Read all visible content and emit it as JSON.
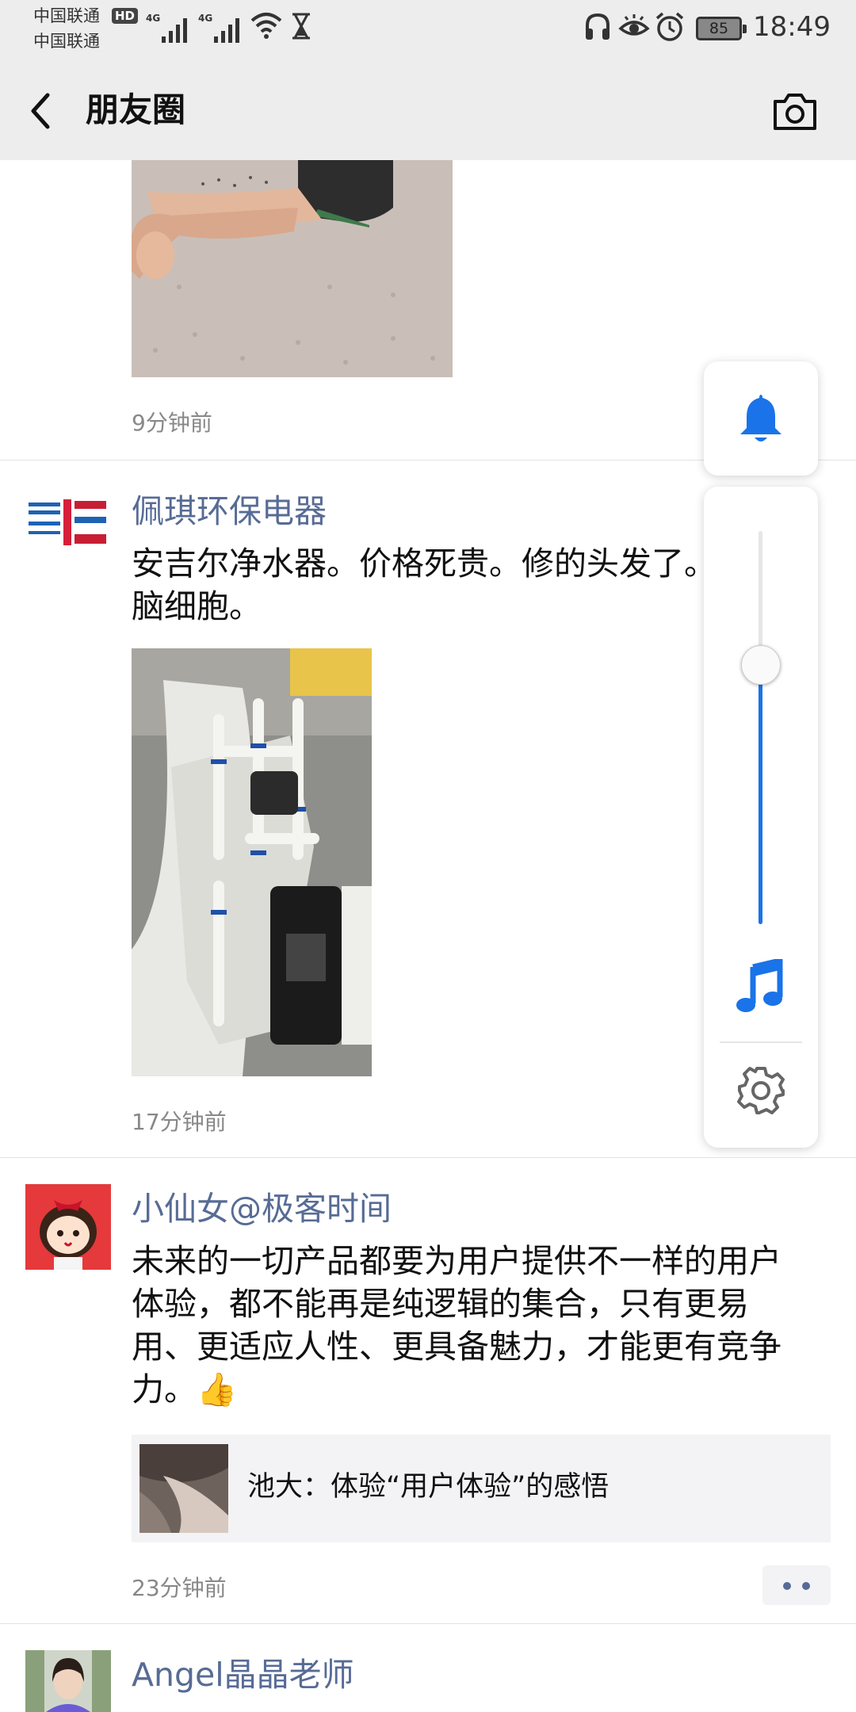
{
  "status_bar": {
    "carrier_1": "中国联通",
    "carrier_2": "中国联通",
    "hd_badge": "HD",
    "signal_1_label": "4G",
    "signal_2_label": "4G",
    "battery_level": "85",
    "time": "18:49"
  },
  "nav": {
    "title": "朋友圈",
    "back_icon": "chevron-left-icon",
    "camera_icon": "camera-icon"
  },
  "posts": [
    {
      "timestamp": "9分钟前"
    },
    {
      "author": "佩琪环保电器",
      "text": "安吉尔净水器。价格死贵。修的头发了。消耗脑细胞。",
      "timestamp": "17分钟前"
    },
    {
      "author": "小仙女@极客时间",
      "text": "未来的一切产品都要为用户提供不一样的用户体验，都不能再是纯逻辑的集合，只有更易用、更适应人性、更具备魅力，才能更有竞争力。👍",
      "link_title": "池大：体验“用户体验”的感悟",
      "timestamp": "23分钟前"
    },
    {
      "author": "Angel晶晶老师"
    }
  ],
  "volume_panel": {
    "level": 0.66,
    "accent_color": "#1a73e8",
    "icons": [
      "bell-icon",
      "music-note-icon",
      "gear-icon"
    ]
  }
}
